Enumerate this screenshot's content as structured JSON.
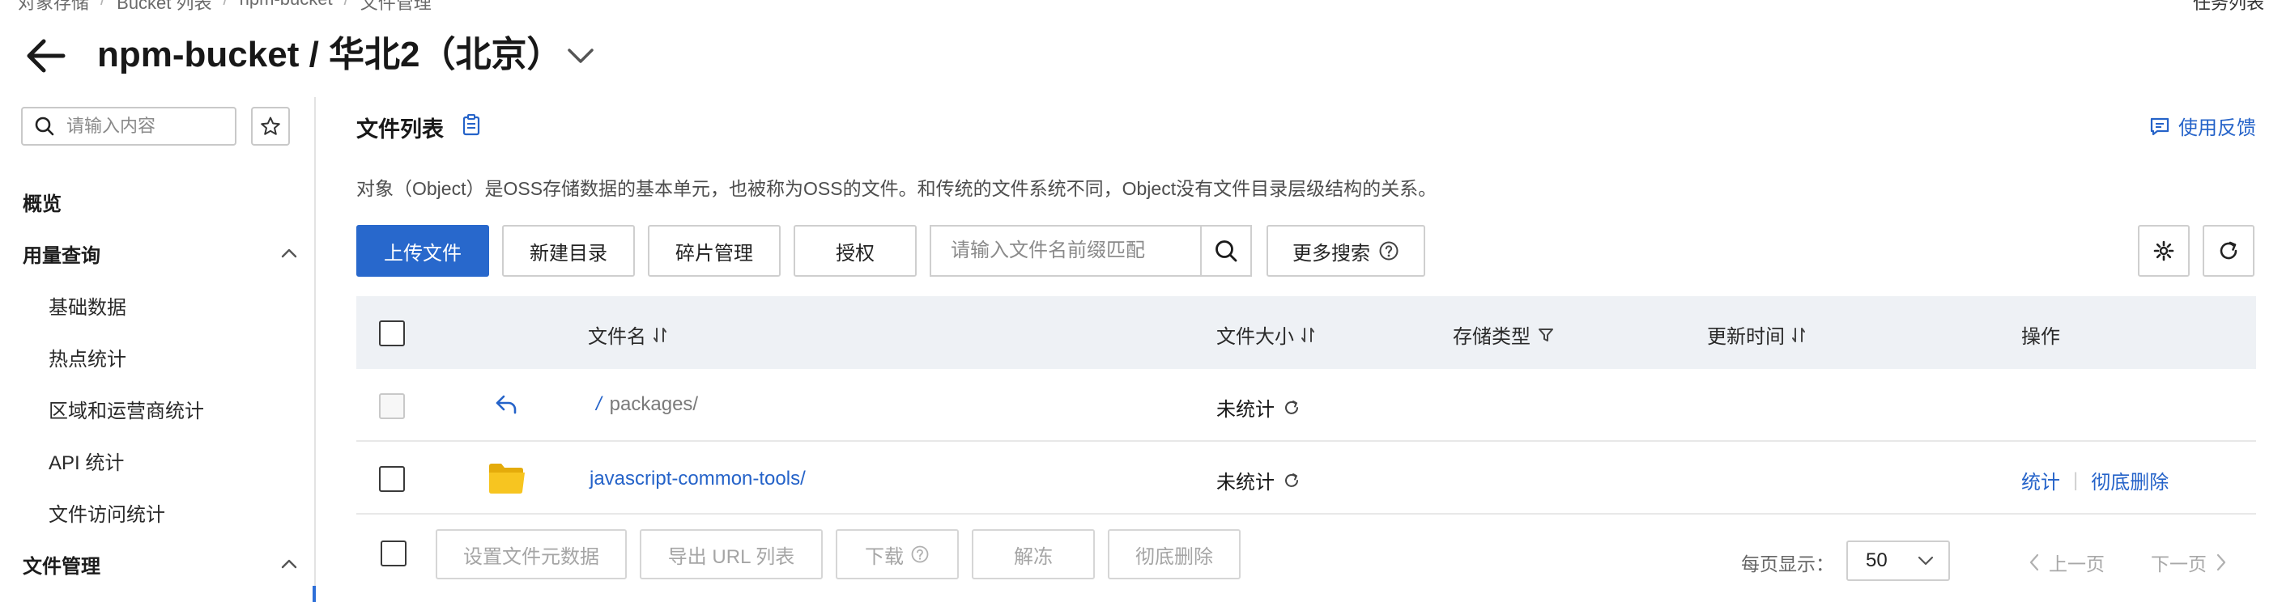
{
  "breadcrumb": [
    "对象存储",
    "Bucket 列表",
    "npm-bucket",
    "文件管理"
  ],
  "header": {
    "title": "npm-bucket / 华北2（北京）",
    "task_list": "任务列表"
  },
  "sidebar": {
    "search_placeholder": "请输入内容",
    "overview": "概览",
    "usage_group": "用量查询",
    "usage_items": [
      "基础数据",
      "热点统计",
      "区域和运营商统计",
      "API 统计",
      "文件访问统计"
    ],
    "file_group": "文件管理"
  },
  "main": {
    "section_title": "文件列表",
    "feedback": "使用反馈",
    "description": "对象（Object）是OSS存储数据的基本单元，也被称为OSS的文件。和传统的文件系统不同，Object没有文件目录层级结构的关系。",
    "toolbar": {
      "upload": "上传文件",
      "new_dir": "新建目录",
      "fragments": "碎片管理",
      "authorize": "授权",
      "search_placeholder": "请输入文件名前缀匹配",
      "more_search": "更多搜索"
    }
  },
  "table": {
    "columns": {
      "name": "文件名",
      "size": "文件大小",
      "storage": "存储类型",
      "updated": "更新时间",
      "actions": "操作"
    },
    "parent_row": {
      "slash": "/",
      "name": "packages/",
      "size": "未统计"
    },
    "rows": [
      {
        "name": "javascript-common-tools/",
        "size": "未统计",
        "action_stats": "统计",
        "action_sep": "|",
        "action_delete": "彻底删除"
      }
    ]
  },
  "footer": {
    "set_meta": "设置文件元数据",
    "export_url": "导出 URL 列表",
    "download": "下载",
    "unfreeze": "解冻",
    "delete": "彻底删除",
    "per_page_label": "每页显示：",
    "per_page_value": "50",
    "prev": "上一页",
    "next": "下一页"
  },
  "colors": {
    "primary": "#2868cc",
    "link": "#2563c9",
    "folder": "#f5c518",
    "header_bg": "#eef1f5"
  }
}
